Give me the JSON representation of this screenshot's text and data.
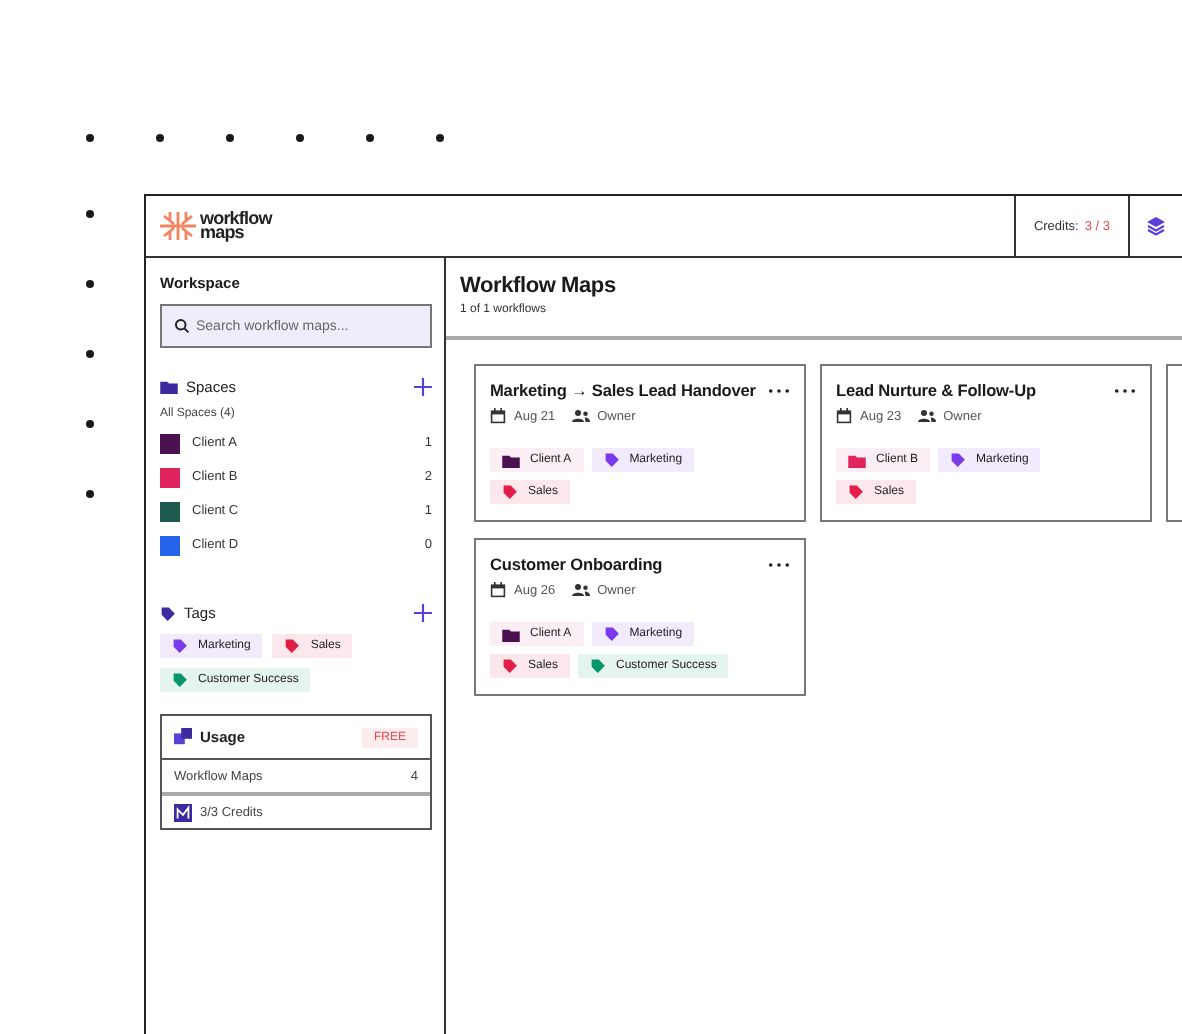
{
  "header": {
    "logo_text": [
      "workflow",
      "maps"
    ],
    "credits_label": "Credits:",
    "credits_value": "3 / 3"
  },
  "sidebar": {
    "workspace_title": "Workspace",
    "search": {
      "placeholder": "Search workflow maps..."
    },
    "spaces": {
      "title": "Spaces",
      "all_label": "All Spaces (4)",
      "items": [
        {
          "name": "Client A",
          "count": "1",
          "color": "#4a1050"
        },
        {
          "name": "Client B",
          "count": "2",
          "color": "#e0245e"
        },
        {
          "name": "Client C",
          "count": "1",
          "color": "#1d5a4e"
        },
        {
          "name": "Client D",
          "count": "0",
          "color": "#2563eb"
        }
      ]
    },
    "tags": {
      "title": "Tags",
      "items": [
        {
          "name": "Marketing",
          "color": "#7c3aed"
        },
        {
          "name": "Sales",
          "color": "#e11d48"
        },
        {
          "name": "Customer Success",
          "color": "#059669"
        }
      ]
    },
    "usage": {
      "title": "Usage",
      "badge": "FREE",
      "rows": [
        {
          "kind": "count",
          "label": "Workflow Maps",
          "value": "4"
        },
        {
          "kind": "credits",
          "label": "3/3 Credits"
        }
      ]
    }
  },
  "main": {
    "title": "Workflow Maps",
    "subtitle": "1 of 1 workflows",
    "cards": [
      {
        "title": "Marketing → Sales Lead Handover",
        "date": "Aug 21",
        "owner": "Owner",
        "chips": [
          {
            "kind": "client",
            "label": "Client A",
            "color": "#4a1050"
          },
          {
            "kind": "tag",
            "label": "Marketing",
            "color": "#7c3aed"
          },
          {
            "kind": "tag",
            "label": "Sales",
            "color": "#e11d48"
          }
        ]
      },
      {
        "title": "Lead Nurture & Follow-Up",
        "date": "Aug 23",
        "owner": "Owner",
        "chips": [
          {
            "kind": "client",
            "label": "Client B",
            "color": "#e0245e"
          },
          {
            "kind": "tag",
            "label": "Marketing",
            "color": "#7c3aed"
          },
          {
            "kind": "tag",
            "label": "Sales",
            "color": "#e11d48"
          }
        ]
      },
      {
        "kind": "cut"
      },
      {
        "title": "Customer Onboarding",
        "date": "Aug 26",
        "owner": "Owner",
        "chips": [
          {
            "kind": "client",
            "label": "Client A",
            "color": "#4a1050"
          },
          {
            "kind": "tag",
            "label": "Marketing",
            "color": "#7c3aed"
          },
          {
            "kind": "tag",
            "label": "Sales",
            "color": "#e11d48"
          },
          {
            "kind": "tag",
            "label": "Customer Success",
            "color": "#059669"
          }
        ]
      }
    ]
  }
}
